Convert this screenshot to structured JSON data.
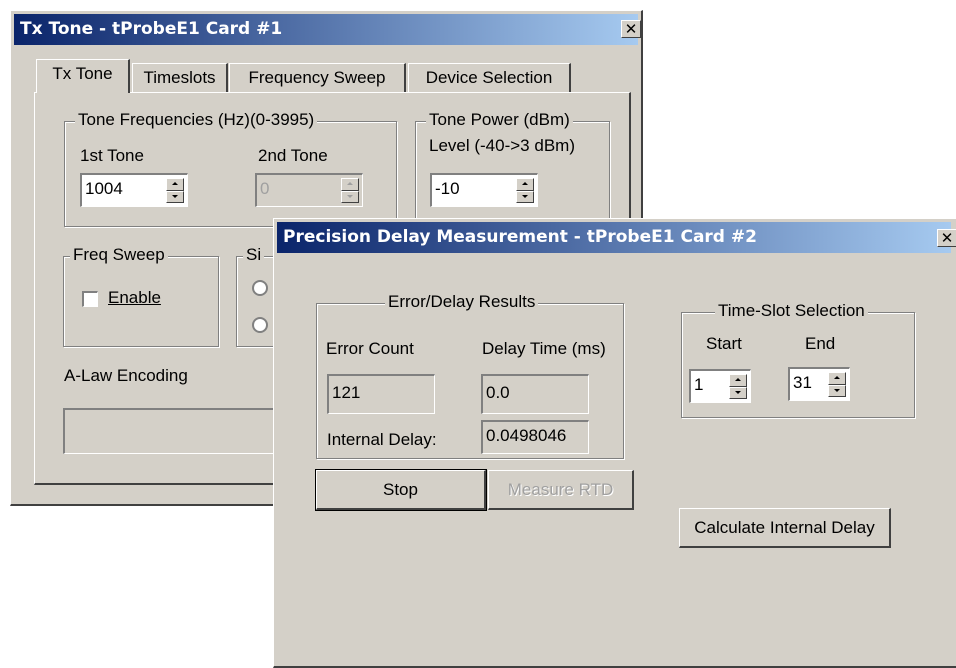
{
  "tx_window": {
    "title": "Tx Tone - tProbeE1 Card #1",
    "close": "✕",
    "tabs": [
      "Tx Tone",
      "Timeslots",
      "Frequency Sweep",
      "Device Selection"
    ],
    "tone_freq": {
      "title": "Tone Frequencies (Hz)(0-3995)",
      "first_label": "1st Tone",
      "first_value": "1004",
      "second_label": "2nd Tone",
      "second_value": "0"
    },
    "tone_power": {
      "title": "Tone Power (dBm)",
      "level_label": "Level (-40->3 dBm)",
      "value": "-10"
    },
    "freq_sweep": {
      "title": "Freq Sweep",
      "enable_label": "Enable"
    },
    "signal_group": {
      "title": "Si"
    },
    "encoding": "A-Law Encoding"
  },
  "pd_window": {
    "title": "Precision Delay Measurement - tProbeE1 Card #2",
    "close": "✕",
    "results": {
      "title": "Error/Delay Results",
      "error_count_label": "Error Count",
      "error_count_value": "121",
      "delay_time_label": "Delay Time (ms)",
      "delay_time_value": "0.0",
      "internal_delay_label": "Internal Delay:",
      "internal_delay_value": "0.0498046"
    },
    "timeslot": {
      "title": "Time-Slot Selection",
      "start_label": "Start",
      "start_value": "1",
      "end_label": "End",
      "end_value": "31"
    },
    "stop_label": "Stop",
    "measure_rtd_label": "Measure RTD",
    "calc_internal_label": "Calculate Internal Delay"
  }
}
